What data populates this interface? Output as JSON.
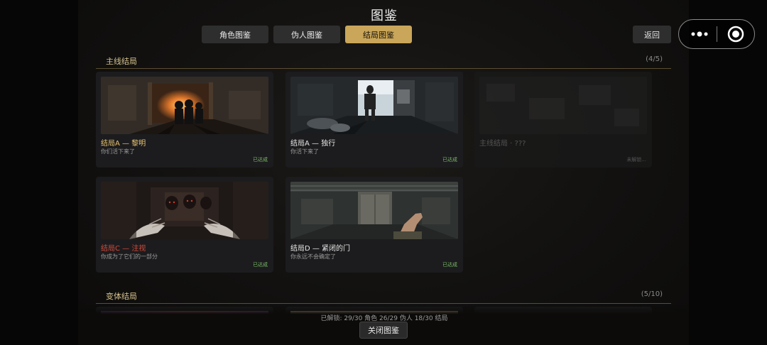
{
  "title": "图鉴",
  "tabs": [
    {
      "label": "角色图鉴",
      "active": false
    },
    {
      "label": "伪人图鉴",
      "active": false
    },
    {
      "label": "结局图鉴",
      "active": true
    }
  ],
  "back_label": "返回",
  "sections": [
    {
      "name": "主线结局",
      "count": "(4/5)",
      "cards": [
        {
          "title": "结局A — 黎明",
          "subtitle": "你们活下来了",
          "status": "已达成",
          "title_color": "gold",
          "locked": false,
          "art": "dawn"
        },
        {
          "title": "结局A — 独行",
          "subtitle": "你活下来了",
          "status": "已达成",
          "title_color": "white",
          "locked": false,
          "art": "alone"
        },
        {
          "title": "主线结局 · ???",
          "subtitle": "",
          "status": "未解锁...",
          "title_color": "dim",
          "locked": true,
          "art": "locked"
        },
        {
          "title": "结局C — 注视",
          "subtitle": "你成为了它们的一部分",
          "status": "已达成",
          "title_color": "red",
          "locked": false,
          "art": "gaze"
        },
        {
          "title": "结局D — 紧闭的门",
          "subtitle": "你永远不会确定了",
          "status": "已达成",
          "title_color": "white",
          "locked": false,
          "art": "door"
        }
      ]
    },
    {
      "name": "变体结局",
      "count": "(5/10)"
    }
  ],
  "stats": "已解锁: 29/30 角色    26/29 伪人    18/30 结局",
  "close_label": "关闭图鉴",
  "miniprogram": {
    "menu_icon": "more-dots-icon",
    "close_icon": "target-close-icon"
  },
  "colors": {
    "accent": "#c9a65a",
    "achieved": "#7dbb6a",
    "red_title": "#d34a3a",
    "gold_title": "#e6c270"
  }
}
